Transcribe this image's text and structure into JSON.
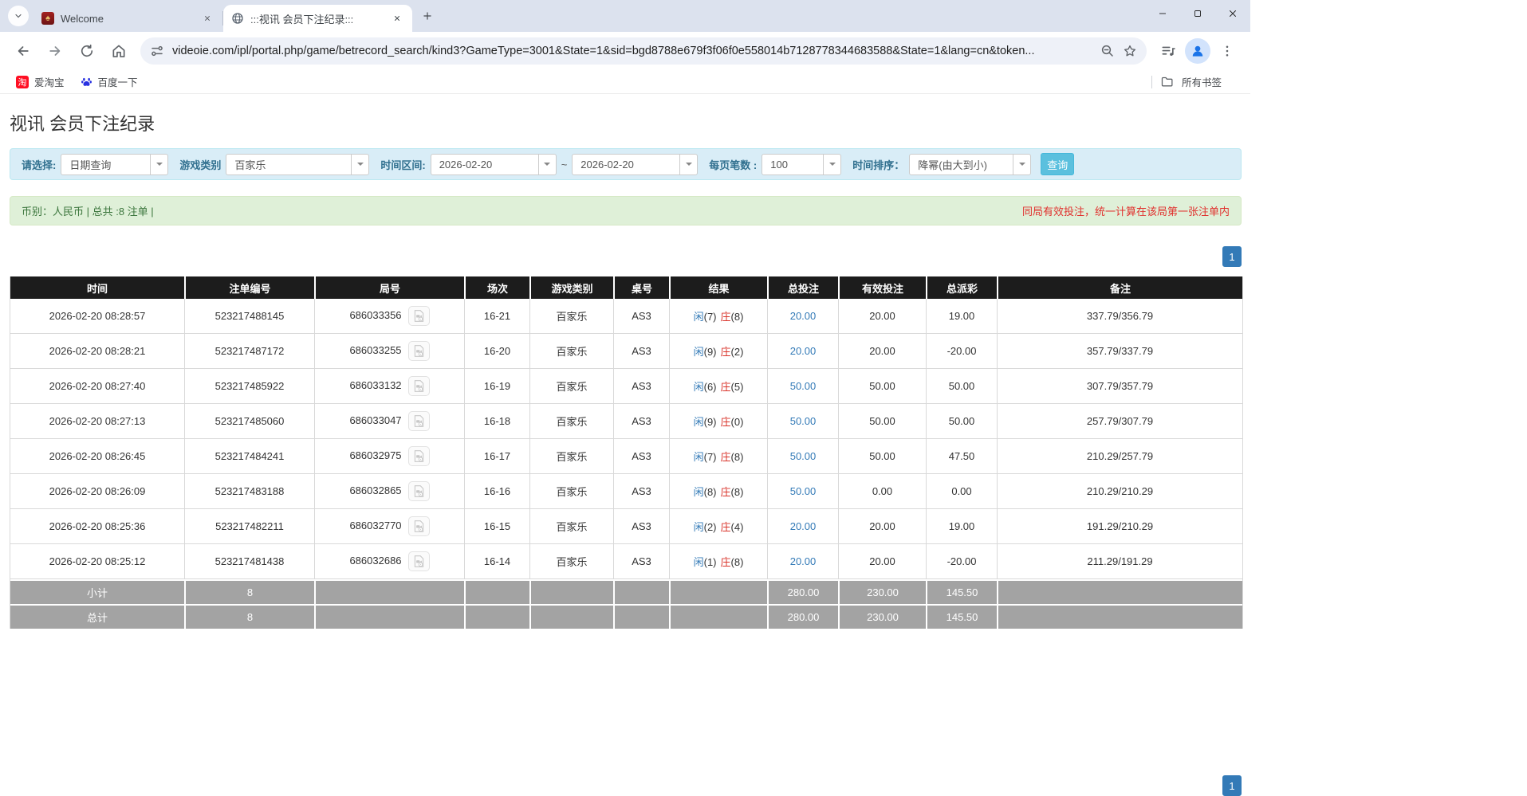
{
  "browser": {
    "tabs": [
      {
        "title": "Welcome"
      },
      {
        "title": ":::视讯 会员下注纪录:::"
      }
    ],
    "url": "videoie.com/ipl/portal.php/game/betrecord_search/kind3?GameType=3001&State=1&sid=bgd8788e679f3f06f0e558014b7128778344683588&State=1&lang=cn&token...",
    "bookmarks": [
      "爱淘宝",
      "百度一下"
    ],
    "all_bookmarks_label": "所有书签"
  },
  "page": {
    "title": "视讯 会员下注纪录",
    "filters": {
      "select_label": "请选择:",
      "select_value": "日期查询",
      "game_type_label": "游戏类别",
      "game_type_value": "百家乐",
      "date_range_label": "时间区间:",
      "date_from": "2026-02-20",
      "tilde": "~",
      "date_to": "2026-02-20",
      "page_size_label": "每页笔数 :",
      "page_size_value": "100",
      "sort_label": "时间排序：",
      "sort_value": "降幂(由大到小)",
      "search_button": "查询"
    },
    "summary_bar": {
      "left": "币别：人民币 | 总共 :8 注单 |",
      "right": "同局有效投注，统一计算在该局第一张注单内"
    },
    "pagination": "1",
    "table": {
      "headers": [
        "时间",
        "注单编号",
        "局号",
        "场次",
        "游戏类别",
        "桌号",
        "结果",
        "总投注",
        "有效投注",
        "总派彩",
        "备注"
      ],
      "rows": [
        {
          "time": "2026-02-20 08:28:57",
          "bet_id": "523217488145",
          "round": "686033356",
          "session": "16-21",
          "game": "百家乐",
          "table": "AS3",
          "rp": "闲",
          "rpn": "(7)",
          "rb": "庄",
          "rbn": "(8)",
          "total": "20.00",
          "valid": "20.00",
          "payout": "19.00",
          "note": "337.79/356.79"
        },
        {
          "time": "2026-02-20 08:28:21",
          "bet_id": "523217487172",
          "round": "686033255",
          "session": "16-20",
          "game": "百家乐",
          "table": "AS3",
          "rp": "闲",
          "rpn": "(9)",
          "rb": "庄",
          "rbn": "(2)",
          "total": "20.00",
          "valid": "20.00",
          "payout": "-20.00",
          "note": "357.79/337.79"
        },
        {
          "time": "2026-02-20 08:27:40",
          "bet_id": "523217485922",
          "round": "686033132",
          "session": "16-19",
          "game": "百家乐",
          "table": "AS3",
          "rp": "闲",
          "rpn": "(6)",
          "rb": "庄",
          "rbn": "(5)",
          "total": "50.00",
          "valid": "50.00",
          "payout": "50.00",
          "note": "307.79/357.79"
        },
        {
          "time": "2026-02-20 08:27:13",
          "bet_id": "523217485060",
          "round": "686033047",
          "session": "16-18",
          "game": "百家乐",
          "table": "AS3",
          "rp": "闲",
          "rpn": "(9)",
          "rb": "庄",
          "rbn": "(0)",
          "total": "50.00",
          "valid": "50.00",
          "payout": "50.00",
          "note": "257.79/307.79"
        },
        {
          "time": "2026-02-20 08:26:45",
          "bet_id": "523217484241",
          "round": "686032975",
          "session": "16-17",
          "game": "百家乐",
          "table": "AS3",
          "rp": "闲",
          "rpn": "(7)",
          "rb": "庄",
          "rbn": "(8)",
          "total": "50.00",
          "valid": "50.00",
          "payout": "47.50",
          "note": "210.29/257.79"
        },
        {
          "time": "2026-02-20 08:26:09",
          "bet_id": "523217483188",
          "round": "686032865",
          "session": "16-16",
          "game": "百家乐",
          "table": "AS3",
          "rp": "闲",
          "rpn": "(8)",
          "rb": "庄",
          "rbn": "(8)",
          "total": "50.00",
          "valid": "0.00",
          "payout": "0.00",
          "note": "210.29/210.29"
        },
        {
          "time": "2026-02-20 08:25:36",
          "bet_id": "523217482211",
          "round": "686032770",
          "session": "16-15",
          "game": "百家乐",
          "table": "AS3",
          "rp": "闲",
          "rpn": "(2)",
          "rb": "庄",
          "rbn": "(4)",
          "total": "20.00",
          "valid": "20.00",
          "payout": "19.00",
          "note": "191.29/210.29"
        },
        {
          "time": "2026-02-20 08:25:12",
          "bet_id": "523217481438",
          "round": "686032686",
          "session": "16-14",
          "game": "百家乐",
          "table": "AS3",
          "rp": "闲",
          "rpn": "(1)",
          "rb": "庄",
          "rbn": "(8)",
          "total": "20.00",
          "valid": "20.00",
          "payout": "-20.00",
          "note": "211.29/191.29"
        }
      ],
      "subtotal_label": "小计",
      "total_label": "总计",
      "count": "8",
      "sum_bet": "280.00",
      "sum_valid": "230.00",
      "sum_payout": "145.50"
    }
  },
  "colors": {
    "accent_blue": "#337ab7",
    "banker_red": "#d9342b",
    "query_cyan": "#5bc0de",
    "header_black": "#1c1c1c"
  }
}
